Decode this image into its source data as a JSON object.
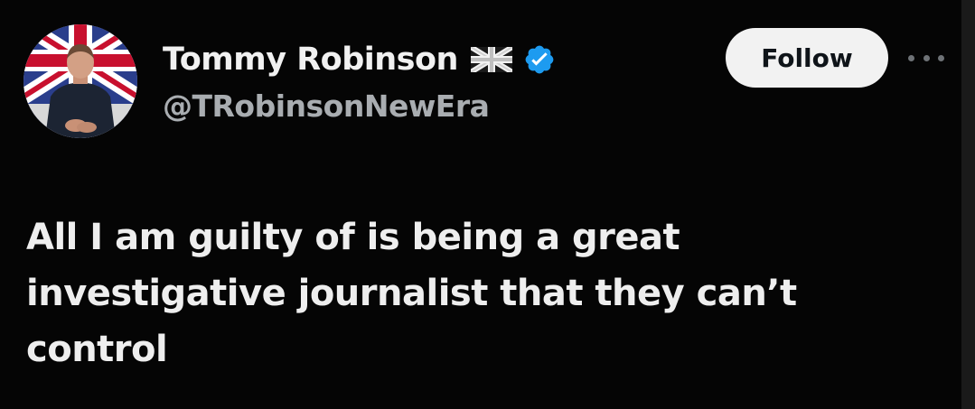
{
  "author": {
    "display_name": "Tommy Robinson",
    "handle": "@TRobinsonNewEra",
    "flag_icon": "uk-flag-icon",
    "verified_icon": "verified-badge-icon",
    "verified_color": "#1d9bf0"
  },
  "actions": {
    "follow_label": "Follow",
    "more_icon": "more-options-icon"
  },
  "tweet": {
    "text": "All I am guilty of is being a great\ninvestigative journalist that they can’t\ncontrol"
  },
  "colors": {
    "background": "#050505",
    "text": "#eeeeee",
    "secondary_text": "#a9adb1",
    "button_bg": "#f2f2f2"
  }
}
